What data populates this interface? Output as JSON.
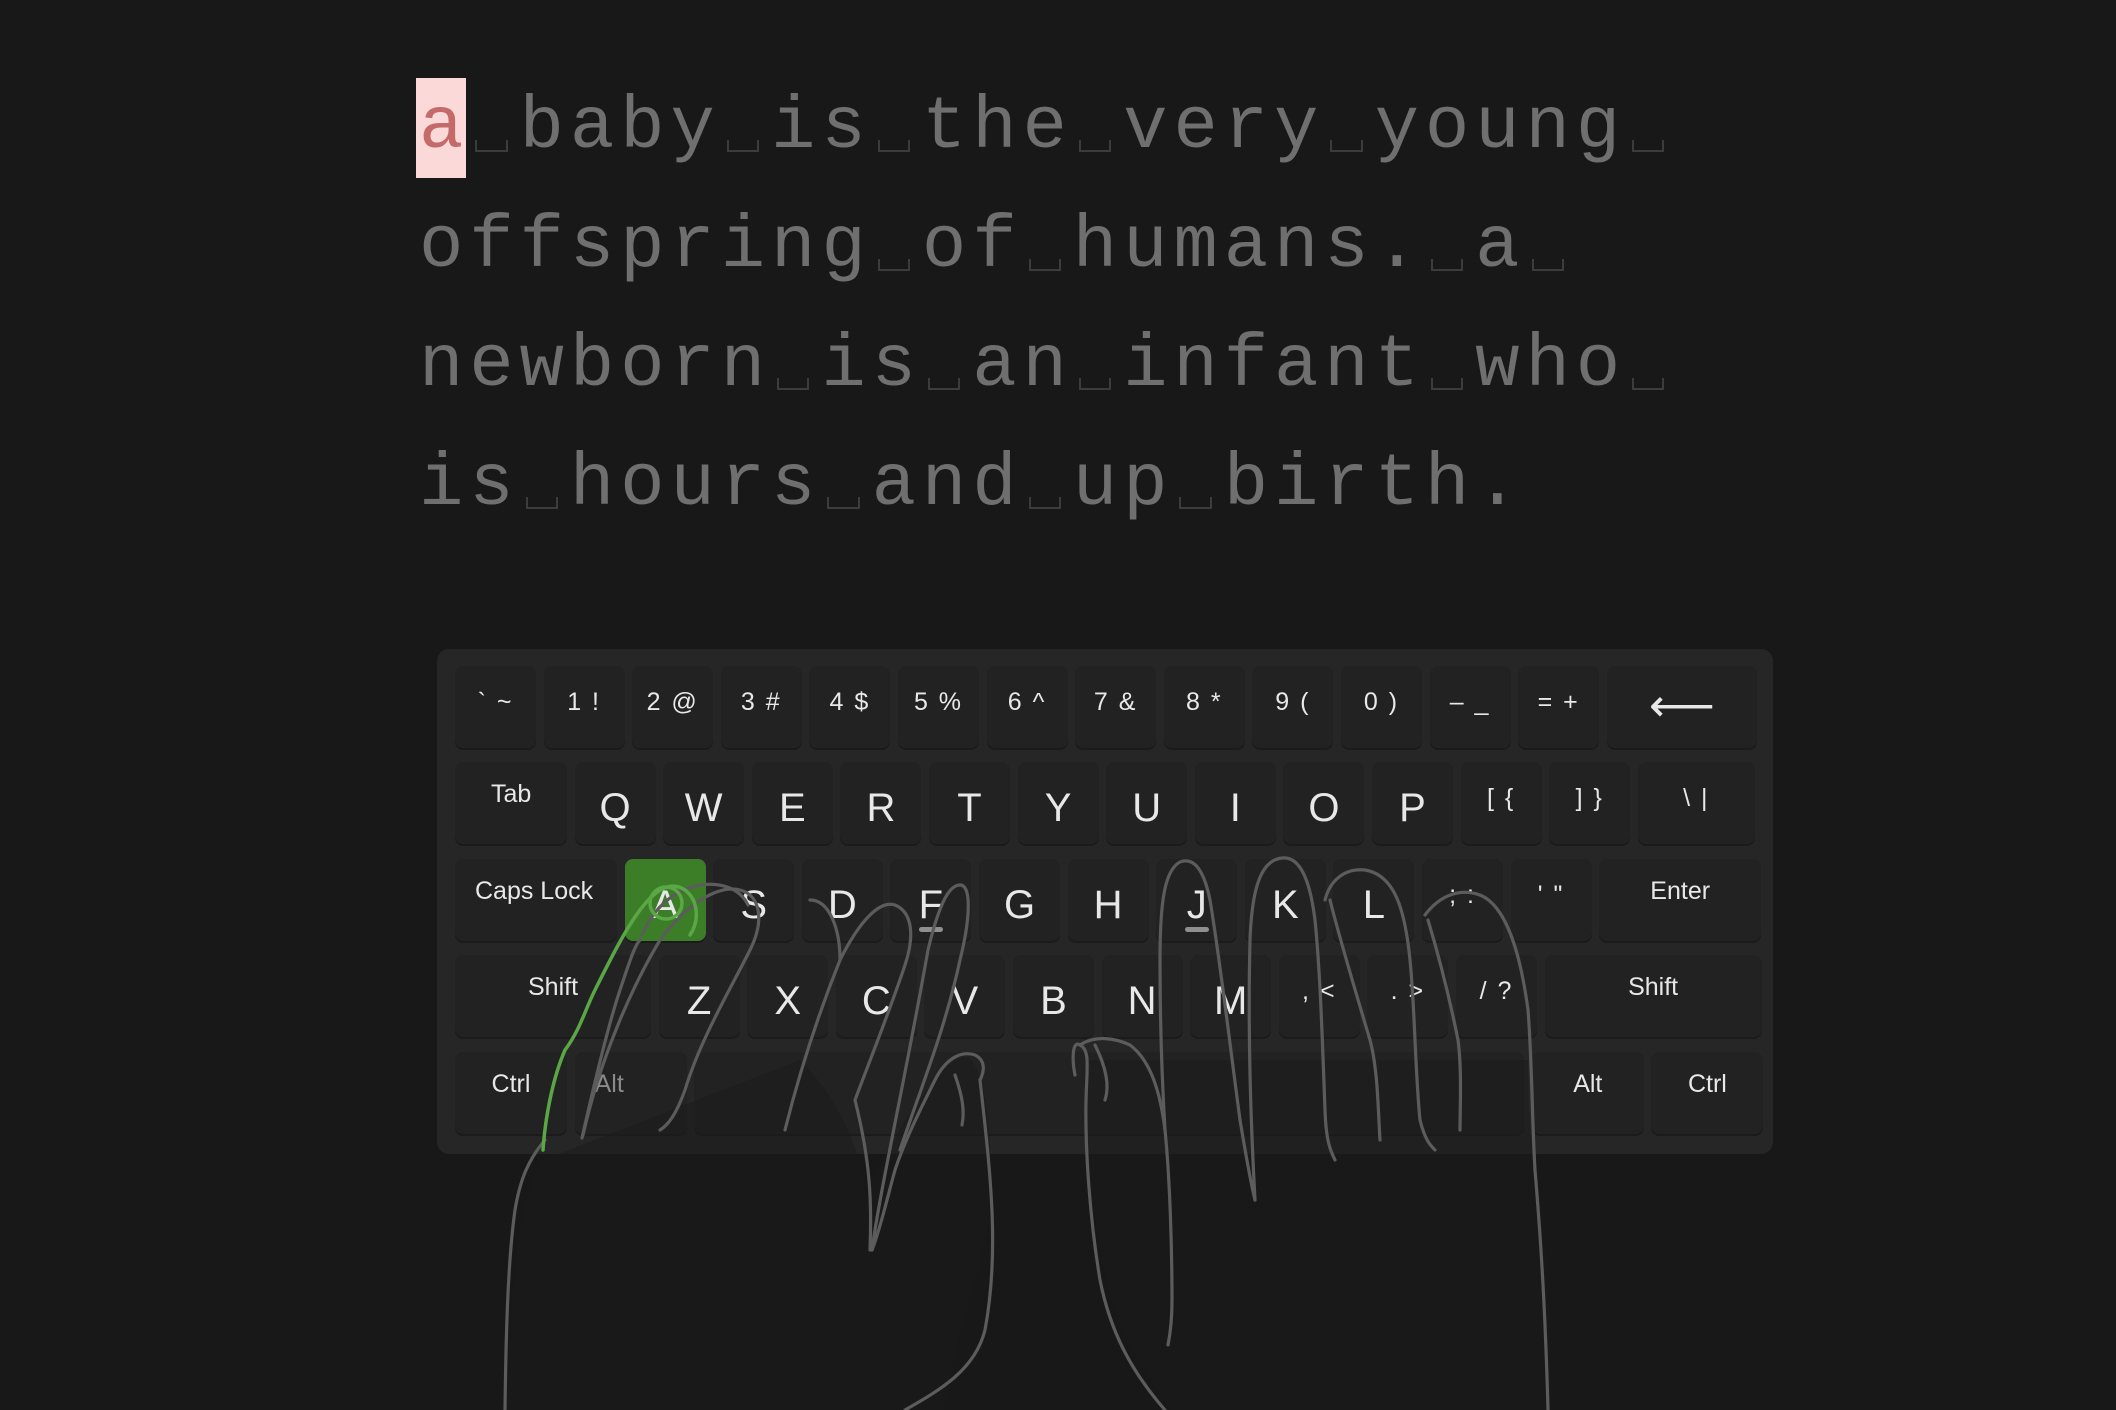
{
  "typing": {
    "lines": [
      "a baby is the very young ",
      "offspring of humans. a ",
      "newborn is an infant who ",
      "is hours and up birth."
    ],
    "cursor": {
      "line": 0,
      "index": 0
    }
  },
  "keyboard": {
    "rows": [
      [
        {
          "label": "` ~",
          "kind": "digit"
        },
        {
          "label": "1 !",
          "kind": "digit"
        },
        {
          "label": "2 @",
          "kind": "digit"
        },
        {
          "label": "3 #",
          "kind": "digit"
        },
        {
          "label": "4 $",
          "kind": "digit"
        },
        {
          "label": "5 %",
          "kind": "digit"
        },
        {
          "label": "6 ^",
          "kind": "digit"
        },
        {
          "label": "7 &",
          "kind": "digit"
        },
        {
          "label": "8 *",
          "kind": "digit"
        },
        {
          "label": "9 (",
          "kind": "digit"
        },
        {
          "label": "0 )",
          "kind": "digit"
        },
        {
          "label": "– _",
          "kind": "digit"
        },
        {
          "label": "= +",
          "kind": "digit"
        },
        {
          "label": "⟵",
          "kind": "backspace"
        }
      ],
      [
        {
          "label": "Tab",
          "kind": "mod"
        },
        {
          "label": "Q",
          "kind": "letter"
        },
        {
          "label": "W",
          "kind": "letter"
        },
        {
          "label": "E",
          "kind": "letter"
        },
        {
          "label": "R",
          "kind": "letter"
        },
        {
          "label": "T",
          "kind": "letter"
        },
        {
          "label": "Y",
          "kind": "letter"
        },
        {
          "label": "U",
          "kind": "letter"
        },
        {
          "label": "I",
          "kind": "letter"
        },
        {
          "label": "O",
          "kind": "letter"
        },
        {
          "label": "P",
          "kind": "letter"
        },
        {
          "label": "[ {",
          "kind": "digit"
        },
        {
          "label": "] }",
          "kind": "digit"
        },
        {
          "label": "\\ |",
          "kind": "digit"
        }
      ],
      [
        {
          "label": "Caps Lock",
          "kind": "mod"
        },
        {
          "label": "A",
          "kind": "letter",
          "active": true
        },
        {
          "label": "S",
          "kind": "letter"
        },
        {
          "label": "D",
          "kind": "letter"
        },
        {
          "label": "F",
          "kind": "letter",
          "home": true
        },
        {
          "label": "G",
          "kind": "letter"
        },
        {
          "label": "H",
          "kind": "letter"
        },
        {
          "label": "J",
          "kind": "letter",
          "home": true
        },
        {
          "label": "K",
          "kind": "letter"
        },
        {
          "label": "L",
          "kind": "letter"
        },
        {
          "label": "; :",
          "kind": "digit"
        },
        {
          "label": "' \"",
          "kind": "digit"
        },
        {
          "label": "Enter",
          "kind": "mod"
        }
      ],
      [
        {
          "label": "Shift",
          "kind": "mod"
        },
        {
          "label": "Z",
          "kind": "letter"
        },
        {
          "label": "X",
          "kind": "letter"
        },
        {
          "label": "C",
          "kind": "letter"
        },
        {
          "label": "V",
          "kind": "letter"
        },
        {
          "label": "B",
          "kind": "letter"
        },
        {
          "label": "N",
          "kind": "letter"
        },
        {
          "label": "M",
          "kind": "letter"
        },
        {
          "label": ", <",
          "kind": "digit"
        },
        {
          "label": ". >",
          "kind": "digit"
        },
        {
          "label": "/ ?",
          "kind": "digit"
        },
        {
          "label": "Shift",
          "kind": "mod"
        }
      ],
      [
        {
          "label": "Ctrl",
          "kind": "mod"
        },
        {
          "label": "Alt",
          "kind": "mod",
          "dim": true
        },
        {
          "label": "",
          "kind": "space"
        },
        {
          "label": "Alt",
          "kind": "mod"
        },
        {
          "label": "Ctrl",
          "kind": "mod"
        }
      ]
    ]
  },
  "colors": {
    "background": "#181818",
    "text_pending": "#6f6f6f",
    "cursor_bg": "#fcd9d9",
    "cursor_fg": "#c56a6a",
    "active_key": "#3c7d27",
    "active_finger": "#5aa746"
  },
  "hands": {
    "icon": "hands-outline-icon",
    "active_finger": "left-pinky"
  }
}
